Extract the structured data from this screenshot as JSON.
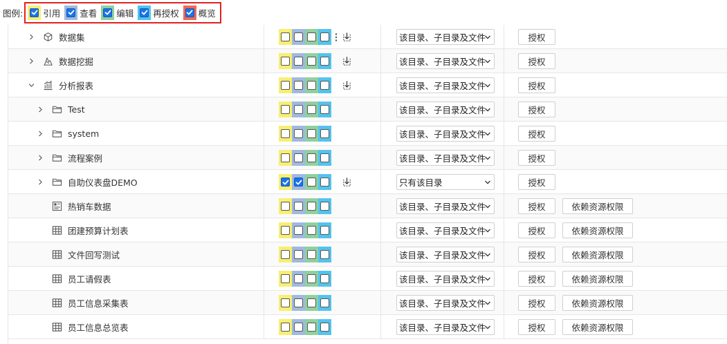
{
  "legend": {
    "title": "图例:",
    "items": [
      {
        "label": "引用",
        "color": "#f7ef72"
      },
      {
        "label": "查看",
        "color": "#9fbadf"
      },
      {
        "label": "编辑",
        "color": "#8fd19e"
      },
      {
        "label": "再授权",
        "color": "#53c3ee"
      },
      {
        "label": "概览",
        "color": "#ef6a55"
      }
    ]
  },
  "perm_colors": [
    "#f7ef72",
    "#9fbadf",
    "#8fd19e",
    "#53c3ee"
  ],
  "check_color": "#1a73e8",
  "buttons": {
    "grant": "授权",
    "dependency": "依赖资源权限"
  },
  "rows": [
    {
      "name": "数据集",
      "level": 1,
      "expander": "collapsed",
      "icon": "cube-icon",
      "perms": [
        false,
        false,
        false,
        false
      ],
      "more": true,
      "inherit_icon": true,
      "scope": "该目录、子目录及文件",
      "dependency": false
    },
    {
      "name": "数据挖掘",
      "level": 1,
      "expander": "collapsed",
      "icon": "mining-icon",
      "perms": [
        false,
        false,
        false,
        false
      ],
      "more": false,
      "inherit_icon": true,
      "scope": "该目录、子目录及文件",
      "dependency": false
    },
    {
      "name": "分析报表",
      "level": 1,
      "expander": "expanded",
      "icon": "bar-chart-icon",
      "perms": [
        false,
        false,
        false,
        false
      ],
      "more": false,
      "inherit_icon": true,
      "scope": "该目录、子目录及文件",
      "dependency": false
    },
    {
      "name": "Test",
      "level": 2,
      "expander": "collapsed",
      "icon": "folder-icon",
      "perms": [
        false,
        false,
        false,
        false
      ],
      "more": false,
      "inherit_icon": false,
      "scope": "该目录、子目录及文件",
      "dependency": false
    },
    {
      "name": "system",
      "level": 2,
      "expander": "collapsed",
      "icon": "folder-icon",
      "perms": [
        false,
        false,
        false,
        false
      ],
      "more": false,
      "inherit_icon": false,
      "scope": "该目录、子目录及文件",
      "dependency": false
    },
    {
      "name": "流程案例",
      "level": 2,
      "expander": "collapsed",
      "icon": "folder-icon",
      "perms": [
        false,
        false,
        false,
        false
      ],
      "more": false,
      "inherit_icon": false,
      "scope": "该目录、子目录及文件",
      "dependency": false
    },
    {
      "name": "自助仪表盘DEMO",
      "level": 2,
      "expander": "collapsed",
      "icon": "folder-icon",
      "perms": [
        true,
        true,
        false,
        false
      ],
      "more": false,
      "inherit_icon": true,
      "scope": "只有该目录",
      "dependency": false
    },
    {
      "name": "热销车数据",
      "level": 2,
      "expander": "none",
      "icon": "dashboard-icon",
      "perms": [
        false,
        false,
        false,
        false
      ],
      "more": false,
      "inherit_icon": false,
      "scope": "该目录、子目录及文件",
      "dependency": true
    },
    {
      "name": "团建预算计划表",
      "level": 2,
      "expander": "none",
      "icon": "table-icon",
      "perms": [
        false,
        false,
        false,
        false
      ],
      "more": false,
      "inherit_icon": false,
      "scope": "该目录、子目录及文件",
      "dependency": true
    },
    {
      "name": "文件回写测试",
      "level": 2,
      "expander": "none",
      "icon": "table-icon",
      "perms": [
        false,
        false,
        false,
        false
      ],
      "more": false,
      "inherit_icon": false,
      "scope": "该目录、子目录及文件",
      "dependency": true
    },
    {
      "name": "员工请假表",
      "level": 2,
      "expander": "none",
      "icon": "table-icon",
      "perms": [
        false,
        false,
        false,
        false
      ],
      "more": false,
      "inherit_icon": false,
      "scope": "该目录、子目录及文件",
      "dependency": true
    },
    {
      "name": "员工信息采集表",
      "level": 2,
      "expander": "none",
      "icon": "table-icon",
      "perms": [
        false,
        false,
        false,
        false
      ],
      "more": false,
      "inherit_icon": false,
      "scope": "该目录、子目录及文件",
      "dependency": true
    },
    {
      "name": "员工信息总览表",
      "level": 2,
      "expander": "none",
      "icon": "table-icon",
      "perms": [
        false,
        false,
        false,
        false
      ],
      "more": false,
      "inherit_icon": false,
      "scope": "该目录、子目录及文件",
      "dependency": true
    }
  ]
}
